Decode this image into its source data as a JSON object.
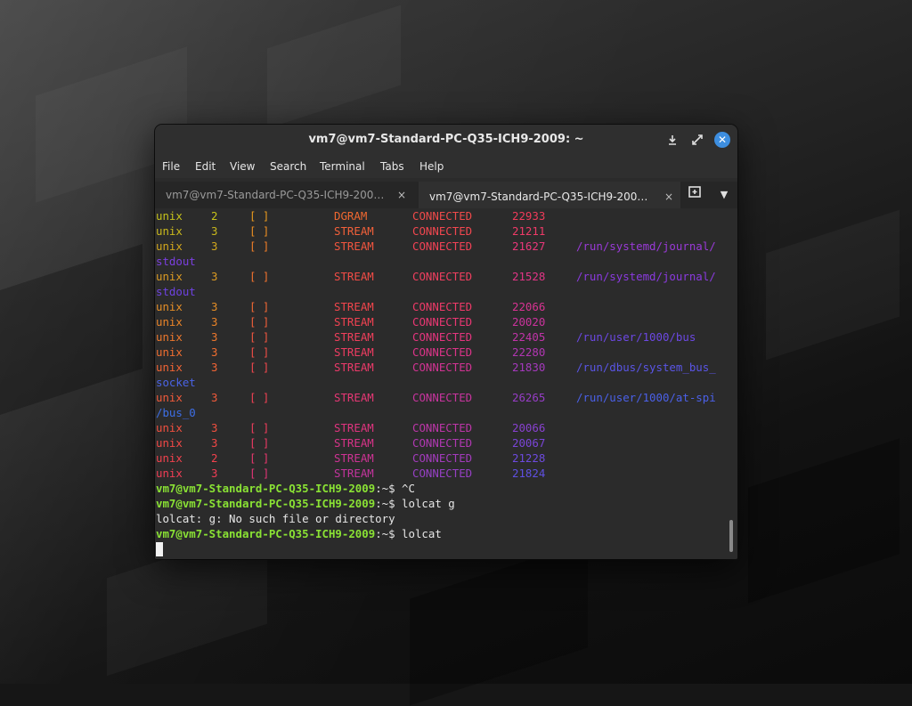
{
  "window": {
    "title": "vm7@vm7-Standard-PC-Q35-ICH9-2009: ~",
    "controls": {
      "minimize": "minimize-icon",
      "maximize": "maximize-icon",
      "close": "close-icon"
    }
  },
  "menu": [
    "File",
    "Edit",
    "View",
    "Search",
    "Terminal",
    "Tabs",
    "Help"
  ],
  "tabs": [
    {
      "label": "vm7@vm7-Standard-PC-Q35-ICH9-200…",
      "close": "×",
      "active": false
    },
    {
      "label": "vm7@vm7-Standard-PC-Q35-ICH9-200…",
      "close": "×",
      "active": true
    }
  ],
  "tab_actions": {
    "new_tab": "new-tab-icon",
    "tabs_menu": "chevron-down-icon"
  },
  "colors": {
    "accent": "#3d8ee0",
    "prompt": "#8ae234"
  },
  "terminal": {
    "netstat_rows": [
      {
        "proto": "unix",
        "refcnt": "2",
        "flags": "[ ]",
        "type": "DGRAM",
        "state": "CONNECTED",
        "inode": "22933",
        "path": "",
        "colors": [
          "#c6c21a",
          "#e89a1e",
          "#f06830",
          "#f04a4a",
          "#f03b5a"
        ]
      },
      {
        "proto": "unix",
        "refcnt": "3",
        "flags": "[ ]",
        "type": "STREAM",
        "state": "CONNECTED",
        "inode": "21211",
        "path": "",
        "colors": [
          "#c9b81c",
          "#eb8e22",
          "#f2603a",
          "#f2474f",
          "#ef3a68"
        ]
      },
      {
        "proto": "unix",
        "refcnt": "3",
        "flags": "[ ]",
        "type": "STREAM",
        "state": "CONNECTED",
        "inode": "21627",
        "path": "/run/systemd/journal/",
        "colors": [
          "#d3a71c",
          "#f07e28",
          "#f2553f",
          "#f24256",
          "#e9377a",
          "#9a3ad8"
        ]
      },
      {
        "proto": "stdout",
        "wrap": true,
        "colors": [
          "#7b3fe0"
        ]
      },
      {
        "proto": "unix",
        "refcnt": "3",
        "flags": "[ ]",
        "type": "STREAM",
        "state": "CONNECTED",
        "inode": "21528",
        "path": "/run/systemd/journal/",
        "colors": [
          "#dc9b22",
          "#f2722e",
          "#f24c46",
          "#f03f5f",
          "#e23586",
          "#8b3ae0"
        ]
      },
      {
        "proto": "stdout",
        "wrap": true,
        "colors": [
          "#6e42e2"
        ]
      },
      {
        "proto": "unix",
        "refcnt": "3",
        "flags": "[ ]",
        "type": "STREAM",
        "state": "CONNECTED",
        "inode": "22066",
        "path": "",
        "colors": [
          "#e58e26",
          "#f26834",
          "#f2454c",
          "#ee3a68",
          "#d83392"
        ]
      },
      {
        "proto": "unix",
        "refcnt": "3",
        "flags": "[ ]",
        "type": "STREAM",
        "state": "CONNECTED",
        "inode": "20020",
        "path": "",
        "colors": [
          "#ea8428",
          "#f25f3a",
          "#f24252",
          "#ea3773",
          "#cc339e"
        ]
      },
      {
        "proto": "unix",
        "refcnt": "3",
        "flags": "[ ]",
        "type": "STREAM",
        "state": "CONNECTED",
        "inode": "22405",
        "path": "/run/user/1000/bus",
        "colors": [
          "#ee782c",
          "#f25640",
          "#f03f5b",
          "#e4357e",
          "#c034a8",
          "#6c48e4"
        ]
      },
      {
        "proto": "unix",
        "refcnt": "3",
        "flags": "[ ]",
        "type": "STREAM",
        "state": "CONNECTED",
        "inode": "22280",
        "path": "",
        "colors": [
          "#f06e30",
          "#f24e46",
          "#ef3c62",
          "#dc3489",
          "#b236b3"
        ]
      },
      {
        "proto": "unix",
        "refcnt": "3",
        "flags": "[ ]",
        "type": "STREAM",
        "state": "CONNECTED",
        "inode": "21830",
        "path": "/run/dbus/system_bus_",
        "colors": [
          "#f26434",
          "#f2474d",
          "#ec3a6a",
          "#d23393",
          "#a539bd",
          "#5a55e6"
        ]
      },
      {
        "proto": "socket",
        "wrap": true,
        "colors": [
          "#4a63e6"
        ]
      },
      {
        "proto": "unix",
        "refcnt": "3",
        "flags": "[ ]",
        "type": "STREAM",
        "state": "CONNECTED",
        "inode": "26265",
        "path": "/run/user/1000/at-spi",
        "colors": [
          "#f25a3a",
          "#f24154",
          "#e73775",
          "#c8349e",
          "#963dc6",
          "#4b60e8"
        ]
      },
      {
        "proto": "/bus_0",
        "wrap": true,
        "colors": [
          "#3d6ee6"
        ]
      },
      {
        "proto": "unix",
        "refcnt": "3",
        "flags": "[ ]",
        "type": "STREAM",
        "state": "CONNECTED",
        "inode": "20066",
        "path": "",
        "colors": [
          "#f2503f",
          "#f03d5c",
          "#e0347f",
          "#bd36a8",
          "#8841d0"
        ]
      },
      {
        "proto": "unix",
        "refcnt": "3",
        "flags": "[ ]",
        "type": "STREAM",
        "state": "CONNECTED",
        "inode": "20067",
        "path": "",
        "colors": [
          "#f24846",
          "#ed3a64",
          "#d83389",
          "#b038b2",
          "#7a45d8"
        ]
      },
      {
        "proto": "unix",
        "refcnt": "2",
        "flags": "[ ]",
        "type": "STREAM",
        "state": "CONNECTED",
        "inode": "21228",
        "path": "",
        "colors": [
          "#f2424d",
          "#e9376e",
          "#ce3394",
          "#a33bbc",
          "#6d4ade"
        ]
      },
      {
        "proto": "unix",
        "refcnt": "3",
        "flags": "[ ]",
        "type": "STREAM",
        "state": "CONNECTED",
        "inode": "21824",
        "path": "",
        "colors": [
          "#f03d55",
          "#e33577",
          "#c4349e",
          "#9640c4",
          "#5f50e2"
        ]
      }
    ],
    "prompt_user": "vm7@vm7-Standard-PC-Q35-ICH9-2009",
    "prompt_path": ":~$",
    "command_lines": [
      {
        "prompt": true,
        "command": " ^C"
      },
      {
        "prompt": true,
        "command": " lolcat g"
      },
      {
        "prompt": false,
        "command": "lolcat: g: No such file or directory"
      },
      {
        "prompt": true,
        "command": " lolcat"
      }
    ]
  }
}
